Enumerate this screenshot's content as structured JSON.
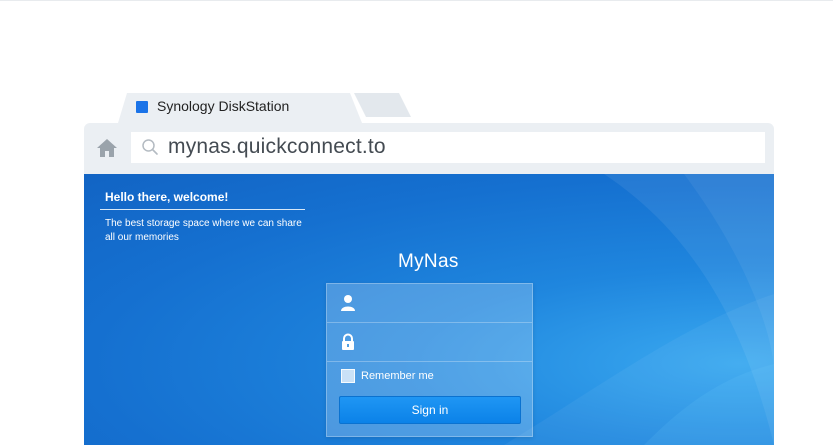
{
  "browser": {
    "tab": {
      "title": "Synology DiskStation",
      "favicon_color": "#1a73e8"
    },
    "address_bar": {
      "url": "mynas.quickconnect.to"
    },
    "icons": {
      "home": "home-icon",
      "search": "search-icon"
    }
  },
  "page": {
    "welcome": {
      "title": "Hello there, welcome!",
      "text": "The best storage space where we can share all our memories"
    },
    "login": {
      "server_name": "MyNas",
      "username_placeholder": "",
      "password_placeholder": "",
      "remember_label": "Remember me",
      "remember_checked": false,
      "signin_label": "Sign in"
    },
    "colors": {
      "background": "#1570d0",
      "button": "#0b82e8"
    }
  }
}
